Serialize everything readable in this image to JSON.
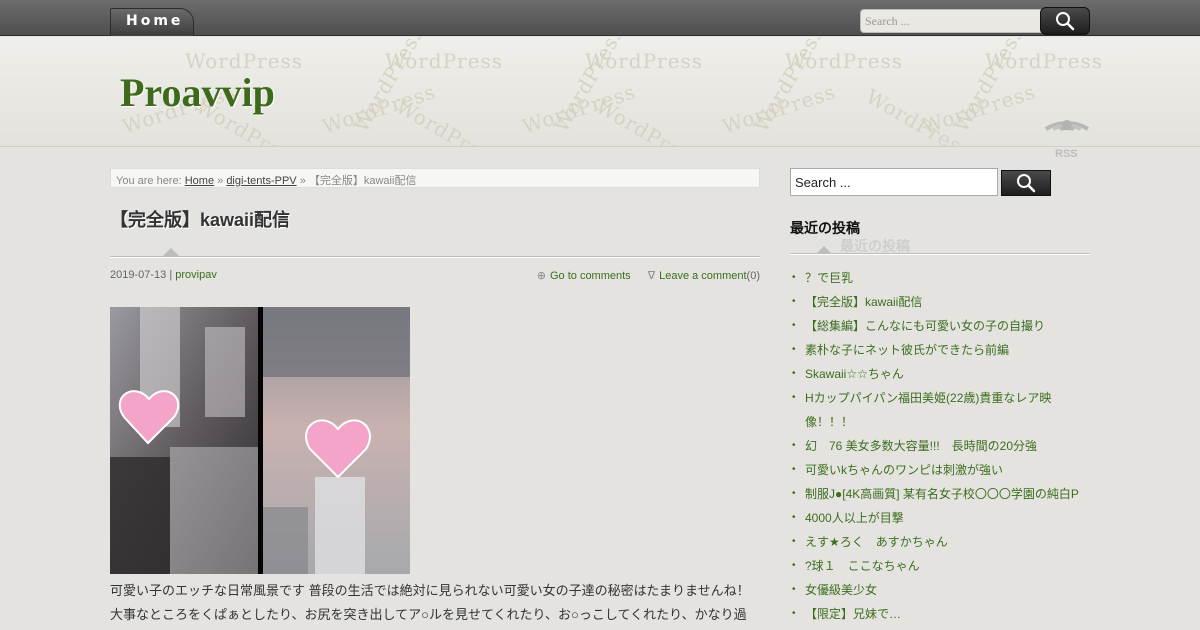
{
  "nav": {
    "home_label": "Home"
  },
  "top_search": {
    "placeholder": "Search ..."
  },
  "header": {
    "site_title": "Proavvip",
    "watermark_text": "WordPress",
    "rss_label": "RSS"
  },
  "breadcrumb": {
    "prefix": "You are here:",
    "home": "Home",
    "sep1": "»",
    "category": "digi-tents-PPV",
    "sep2": "»",
    "current": "【完全版】kawaii配信"
  },
  "post": {
    "title": "【完全版】kawaii配信",
    "date": "2019-07-13",
    "date_sep": "|",
    "author": "provipav",
    "go_to_comments_symbol": "⊕",
    "go_to_comments": "Go to comments",
    "leave_comment_symbol": "∇",
    "leave_comment": "Leave a comment",
    "comment_count": "(0)",
    "body_line1": "可愛い子のエッチな日常風景です 普段の生活では絶対に見られない可愛い女の子達の秘密はたまりませんね！",
    "body_line2": "大事なところをくぱぁとしたり、お尻を突き出してア○ルを見せてくれたり、お○っこしてくれたり、かなり過"
  },
  "sidebar": {
    "search_value": "Search ...",
    "widget_title": "最近の投稿",
    "recent_posts": [
      "？で巨乳",
      "【完全版】kawaii配信",
      "【総集編】こんなにも可愛い女の子の自撮り",
      "素朴な子にネット彼氏ができたら前編",
      "Skawaii☆☆ちゃん",
      "Hカップパイパン福田美姫(22歳)貴重なレア映像！！！",
      "幻　76 美女多数大容量!!!　長時間の20分強",
      "可愛いkちゃんのワンピは刺激が強い",
      "制服J●[4K高画質] 某有名女子校〇〇〇学園の純白P",
      "4000人以上が目撃",
      "えす★ろく　あすかちゃん",
      "?球１　ここなちゃん",
      "女優級美少女",
      "【限定】兄妹で…"
    ]
  },
  "colors": {
    "link_green": "#3c6e1f",
    "title_green": "#3e6a1c",
    "topbar_dark": "#4e4e4e",
    "background": "#e4e3df"
  }
}
